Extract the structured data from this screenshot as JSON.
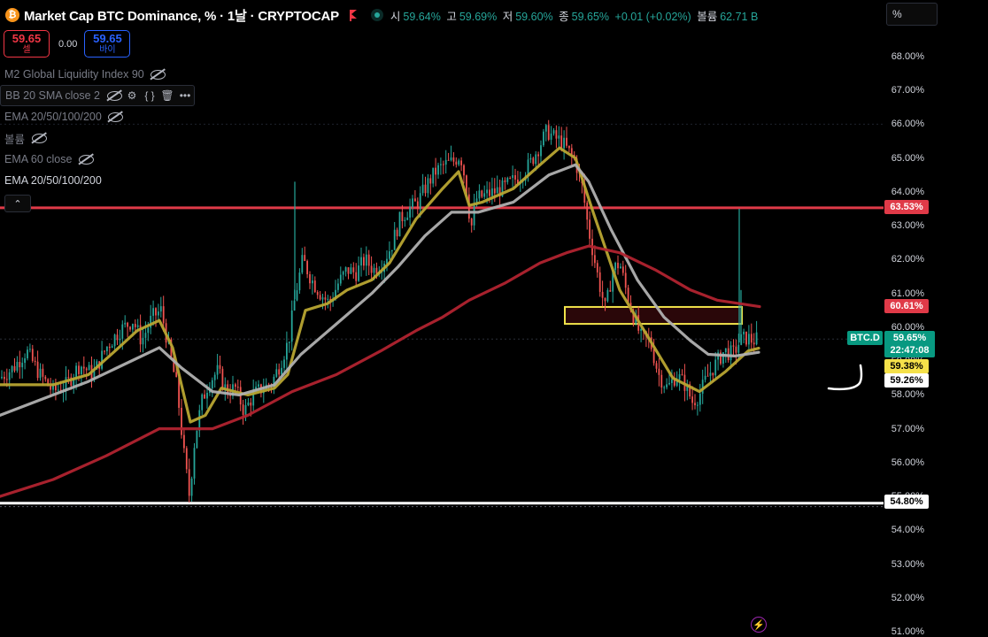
{
  "header": {
    "logo": "₿",
    "title": "Market Cap BTC Dominance, % · 1날 · CRYPTOCAP",
    "ohlc": [
      {
        "label": "시",
        "value": "59.64%"
      },
      {
        "label": "고",
        "value": "59.69%"
      },
      {
        "label": "저",
        "value": "59.60%"
      },
      {
        "label": "종",
        "value": "59.65%"
      },
      {
        "label": "",
        "value": "+0.01 (+0.02%)"
      },
      {
        "label": "볼륨",
        "value": "62.71 B"
      }
    ],
    "search_value": "%"
  },
  "trade": {
    "sell_price": "59.65",
    "sell_label": "셀",
    "spread": "0.00",
    "buy_price": "59.65",
    "buy_label": "바이"
  },
  "indicators": [
    {
      "name": "M2 Global Liquidity Index 90",
      "icons": [
        "eye-off-icon"
      ]
    },
    {
      "name": "BB 20 SMA close 2",
      "icons": [
        "eye-off-icon",
        "settings-icon",
        "source-code-icon",
        "trash-icon",
        "more-icon"
      ]
    },
    {
      "name": "EMA 20/50/100/200",
      "icons": [
        "eye-off-icon"
      ]
    },
    {
      "name": "볼륨",
      "icons": [
        "eye-off-icon"
      ]
    },
    {
      "name": "EMA 60 close",
      "icons": [
        "eye-off-icon"
      ]
    },
    {
      "name": "EMA 20/50/100/200",
      "icons": []
    }
  ],
  "collapse_glyph": "⌃",
  "price_labels": {
    "resistance": "63.53%",
    "ema_red": "60.61%",
    "symbol": "BTC.D",
    "current": "59.65%",
    "countdown": "22:47:08",
    "ema_yellow": "59.38%",
    "ema_white": "59.26%",
    "support": "54.80%"
  },
  "colors": {
    "up": "#26a69a",
    "down": "#ef5350",
    "ema_fast": "#b8a532",
    "ema_mid": "#b0b0b0",
    "ema_slow": "#b0232f",
    "resistance": "#e03a48",
    "support": "#ffffff",
    "zone_border": "#f0e24a",
    "zone_fill": "#2a0709"
  },
  "chart_data": {
    "type": "candlestick",
    "ylim": [
      51,
      68.5
    ],
    "yticks": [
      51,
      52,
      53,
      54,
      55,
      56,
      57,
      58,
      59,
      60,
      61,
      62,
      63,
      64,
      65,
      66,
      67,
      68
    ],
    "ytick_labels": [
      "51.00%",
      "52.00%",
      "53.00%",
      "54.00%",
      "55.00%",
      "56.00%",
      "57.00%",
      "58.00%",
      "59.00%",
      "60.00%",
      "61.00%",
      "62.00%",
      "63.00%",
      "64.00%",
      "65.00%",
      "66.00%",
      "67.00%",
      "68.00%"
    ],
    "horizontal_lines": [
      {
        "value": 63.53,
        "color": "#e03a48"
      },
      {
        "value": 54.8,
        "color": "#ffffff"
      }
    ],
    "zone": {
      "low": 60.1,
      "high": 60.6
    },
    "price_path": [
      [
        0,
        58.5
      ],
      [
        15,
        58.8
      ],
      [
        30,
        59.3
      ],
      [
        45,
        58.6
      ],
      [
        60,
        58.1
      ],
      [
        75,
        58.3
      ],
      [
        90,
        58.9
      ],
      [
        105,
        58.6
      ],
      [
        120,
        59.4
      ],
      [
        135,
        59.9
      ],
      [
        150,
        60.2
      ],
      [
        160,
        59.6
      ],
      [
        172,
        60.3
      ],
      [
        182,
        60.5
      ],
      [
        192,
        59.2
      ],
      [
        200,
        58.2
      ],
      [
        208,
        56.2
      ],
      [
        214,
        55.0
      ],
      [
        220,
        56.7
      ],
      [
        228,
        57.8
      ],
      [
        236,
        58.4
      ],
      [
        246,
        58.7
      ],
      [
        256,
        58.1
      ],
      [
        266,
        58.2
      ],
      [
        276,
        57.5
      ],
      [
        286,
        58.0
      ],
      [
        296,
        58.2
      ],
      [
        306,
        58.3
      ],
      [
        316,
        58.9
      ],
      [
        326,
        59.6
      ],
      [
        334,
        61.0
      ],
      [
        342,
        62.0
      ],
      [
        352,
        61.4
      ],
      [
        362,
        61.0
      ],
      [
        372,
        60.7
      ],
      [
        382,
        61.3
      ],
      [
        392,
        61.7
      ],
      [
        402,
        61.6
      ],
      [
        412,
        62.0
      ],
      [
        422,
        61.7
      ],
      [
        432,
        61.9
      ],
      [
        442,
        62.4
      ],
      [
        452,
        63.2
      ],
      [
        462,
        63.5
      ],
      [
        472,
        63.7
      ],
      [
        482,
        64.2
      ],
      [
        492,
        64.6
      ],
      [
        502,
        64.8
      ],
      [
        512,
        64.9
      ],
      [
        520,
        65.1
      ],
      [
        526,
        64.3
      ],
      [
        532,
        62.9
      ],
      [
        538,
        63.8
      ],
      [
        548,
        63.9
      ],
      [
        558,
        64.0
      ],
      [
        568,
        64.1
      ],
      [
        578,
        64.3
      ],
      [
        588,
        64.5
      ],
      [
        598,
        64.8
      ],
      [
        608,
        65.3
      ],
      [
        618,
        65.8
      ],
      [
        626,
        65.6
      ],
      [
        634,
        65.5
      ],
      [
        642,
        65.2
      ],
      [
        650,
        64.9
      ],
      [
        658,
        64.1
      ],
      [
        664,
        63.0
      ],
      [
        670,
        62.2
      ],
      [
        676,
        61.4
      ],
      [
        684,
        60.5
      ],
      [
        692,
        61.7
      ],
      [
        700,
        61.9
      ],
      [
        708,
        61.0
      ],
      [
        716,
        60.3
      ],
      [
        724,
        59.7
      ],
      [
        734,
        59.6
      ],
      [
        744,
        58.6
      ],
      [
        754,
        58.2
      ],
      [
        764,
        58.6
      ],
      [
        774,
        58.3
      ],
      [
        782,
        57.8
      ],
      [
        790,
        58.0
      ],
      [
        798,
        58.5
      ],
      [
        808,
        58.9
      ],
      [
        818,
        59.3
      ],
      [
        828,
        59.2
      ],
      [
        836,
        59.6
      ],
      [
        844,
        59.7
      ],
      [
        850,
        59.6
      ],
      [
        856,
        59.65
      ]
    ],
    "spikes": [
      {
        "x": 333,
        "high": 64.3
      },
      {
        "x": 835,
        "high": 63.5
      },
      {
        "x": 837,
        "high": 61.1
      }
    ],
    "series": [
      {
        "type": "ema_fast",
        "points": [
          [
            0,
            58.3
          ],
          [
            60,
            58.3
          ],
          [
            100,
            58.6
          ],
          [
            130,
            59.3
          ],
          [
            155,
            59.9
          ],
          [
            180,
            60.2
          ],
          [
            195,
            59.4
          ],
          [
            215,
            57.2
          ],
          [
            232,
            57.4
          ],
          [
            250,
            58.2
          ],
          [
            280,
            58.0
          ],
          [
            310,
            58.2
          ],
          [
            325,
            58.6
          ],
          [
            345,
            60.5
          ],
          [
            370,
            60.7
          ],
          [
            392,
            61.1
          ],
          [
            420,
            61.4
          ],
          [
            440,
            61.9
          ],
          [
            470,
            63.2
          ],
          [
            500,
            64.1
          ],
          [
            518,
            64.6
          ],
          [
            530,
            63.6
          ],
          [
            545,
            63.7
          ],
          [
            580,
            64.1
          ],
          [
            610,
            64.8
          ],
          [
            632,
            65.3
          ],
          [
            650,
            65.0
          ],
          [
            670,
            63.4
          ],
          [
            700,
            61.1
          ],
          [
            730,
            59.8
          ],
          [
            760,
            58.5
          ],
          [
            790,
            58.1
          ],
          [
            820,
            58.7
          ],
          [
            845,
            59.3
          ],
          [
            857,
            59.38
          ]
        ]
      },
      {
        "type": "ema_mid",
        "points": [
          [
            0,
            57.4
          ],
          [
            60,
            58.0
          ],
          [
            100,
            58.4
          ],
          [
            140,
            58.9
          ],
          [
            180,
            59.4
          ],
          [
            205,
            58.8
          ],
          [
            240,
            58.1
          ],
          [
            270,
            58.0
          ],
          [
            310,
            58.3
          ],
          [
            340,
            59.2
          ],
          [
            380,
            60.1
          ],
          [
            420,
            61.0
          ],
          [
            450,
            61.8
          ],
          [
            480,
            62.7
          ],
          [
            510,
            63.4
          ],
          [
            540,
            63.4
          ],
          [
            580,
            63.7
          ],
          [
            620,
            64.5
          ],
          [
            650,
            64.8
          ],
          [
            665,
            64.3
          ],
          [
            690,
            62.9
          ],
          [
            720,
            61.4
          ],
          [
            750,
            60.3
          ],
          [
            780,
            59.6
          ],
          [
            800,
            59.2
          ],
          [
            830,
            59.15
          ],
          [
            857,
            59.26
          ]
        ]
      },
      {
        "type": "ema_slow",
        "points": [
          [
            0,
            55.0
          ],
          [
            60,
            55.5
          ],
          [
            120,
            56.2
          ],
          [
            180,
            57.0
          ],
          [
            210,
            57.0
          ],
          [
            240,
            57.0
          ],
          [
            280,
            57.4
          ],
          [
            330,
            58.1
          ],
          [
            380,
            58.6
          ],
          [
            430,
            59.3
          ],
          [
            470,
            59.9
          ],
          [
            500,
            60.3
          ],
          [
            530,
            60.8
          ],
          [
            570,
            61.3
          ],
          [
            610,
            61.9
          ],
          [
            640,
            62.2
          ],
          [
            665,
            62.4
          ],
          [
            700,
            62.2
          ],
          [
            740,
            61.7
          ],
          [
            780,
            61.1
          ],
          [
            810,
            60.8
          ],
          [
            858,
            60.61
          ]
        ]
      }
    ]
  }
}
